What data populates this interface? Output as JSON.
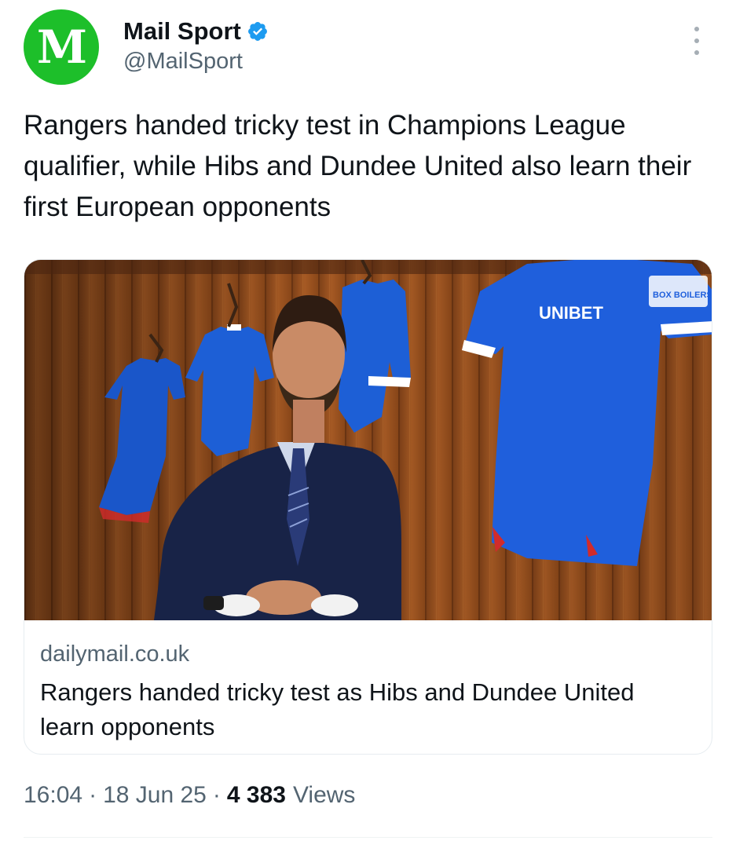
{
  "author": {
    "avatar_glyph": "M",
    "display_name": "Mail Sport",
    "handle": "@MailSport",
    "verified": true,
    "avatar_color": "#1dbf2a",
    "verified_color": "#1d9bf0"
  },
  "tweet": {
    "text": "Rangers handed tricky test in Champions League qualifier, while Hibs and Dundee United also learn their first European opponents"
  },
  "link_card": {
    "image_description": "Man in suit in locker room with blue Rangers shirts hanging on wooden wall",
    "shirt_sponsor": "UNIBET",
    "shirt_sleeve_sponsor": "BOX BOILERS",
    "domain": "dailymail.co.uk",
    "title": "Rangers handed tricky test as Hibs and Dundee United learn opponents"
  },
  "meta": {
    "time": "16:04",
    "date": "18 Jun 25",
    "views_count": "4 383",
    "views_label": "Views",
    "separator": "·"
  }
}
